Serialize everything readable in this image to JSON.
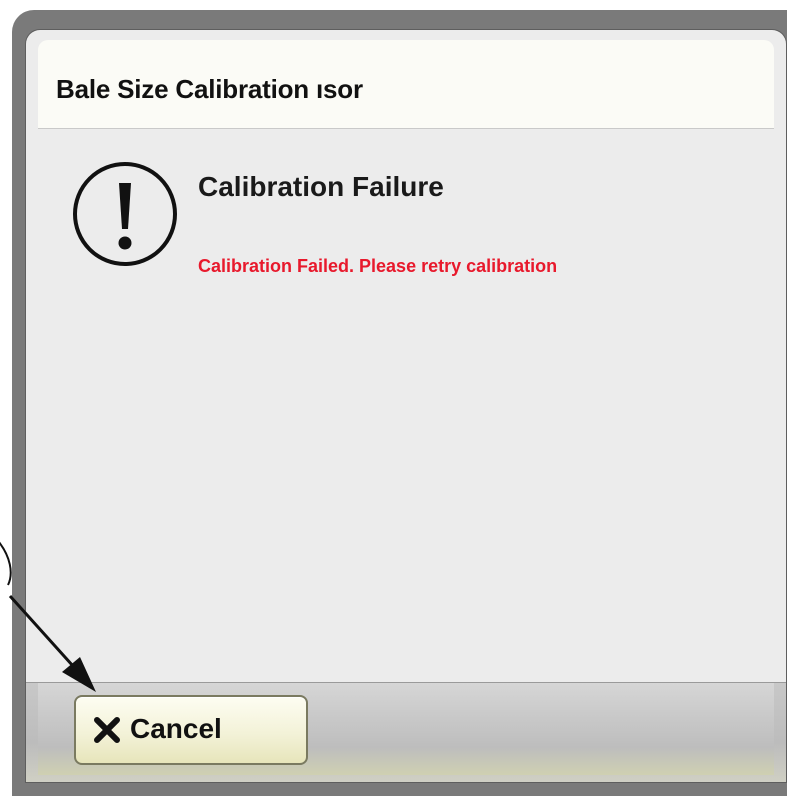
{
  "dialog": {
    "title": "Bale Size Calibration ısor",
    "message_title": "Calibration Failure",
    "message_text": "Calibration Failed. Please retry calibration",
    "icon": "exclamation-circle-icon"
  },
  "footer": {
    "cancel_label": "Cancel",
    "cancel_icon": "close-x-icon"
  },
  "colors": {
    "error_text": "#e8192c",
    "button_face": "#f3f2d8",
    "dialog_body": "#ececec",
    "frame": "#7a7a7a"
  },
  "annotations": {
    "callout_icon": "callout-arrow"
  }
}
